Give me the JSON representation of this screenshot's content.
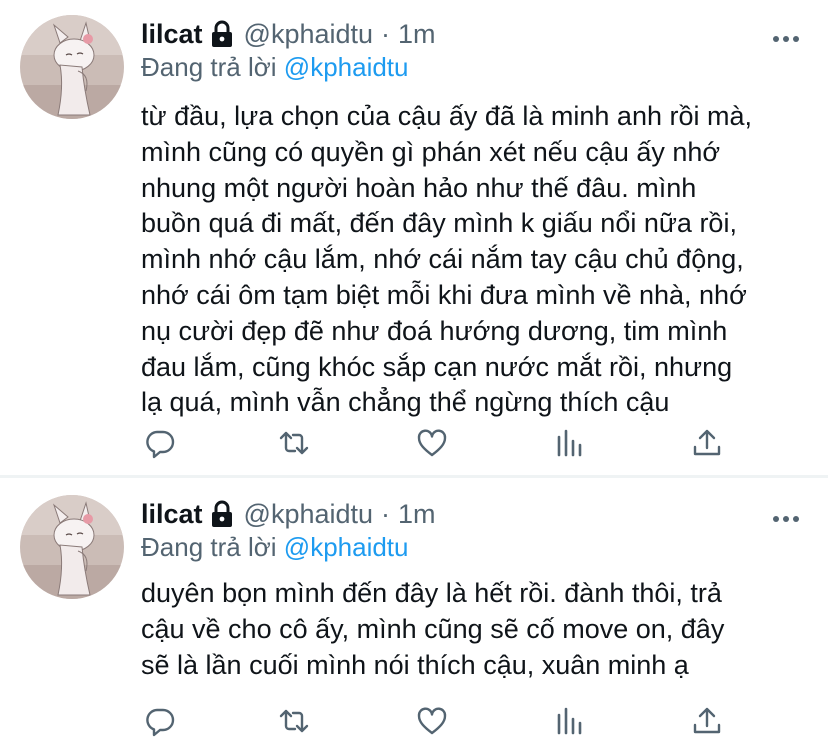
{
  "colors": {
    "text": "#0f1419",
    "secondary": "#536471",
    "link": "#1d9bf0",
    "divider": "#eff3f4"
  },
  "tweets": [
    {
      "display_name": "lilcat",
      "handle": "@kphaidtu",
      "separator": "·",
      "time": "1m",
      "reply_prefix": "Đang trả lời",
      "reply_to": "@kphaidtu",
      "lines": [
        "từ đầu, lựa chọn của cậu ấy đã là minh anh rồi mà,",
        "mình cũng có quyền gì phán xét nếu cậu ấy nhớ",
        "nhung một người hoàn hảo như thế đâu.  mình",
        "buồn quá đi mất, đến đây mình k giấu nổi nữa rồi,",
        "mình nhớ cậu lắm, nhớ cái nắm tay cậu chủ động,",
        "nhớ cái ôm tạm biệt mỗi khi đưa mình về nhà, nhớ",
        "nụ cười đẹp đẽ như đoá hướng dương, tim mình",
        "đau lắm, cũng khóc sắp cạn nước mắt rồi, nhưng",
        "lạ quá, mình vẫn chẳng thể ngừng thích cậu"
      ],
      "icons": [
        "reply-icon",
        "retweet-icon",
        "like-icon",
        "stats-icon",
        "share-icon"
      ]
    },
    {
      "display_name": "lilcat",
      "handle": "@kphaidtu",
      "separator": "·",
      "time": "1m",
      "reply_prefix": "Đang trả lời",
      "reply_to": "@kphaidtu",
      "lines": [
        "duyên bọn mình đến đây là hết rồi. đành thôi, trả",
        "cậu về cho cô ấy, mình cũng sẽ cố move on, đây",
        "sẽ là lần cuối mình nói thích cậu, xuân minh ạ"
      ],
      "icons": [
        "reply-icon",
        "retweet-icon",
        "like-icon",
        "stats-icon",
        "share-icon"
      ]
    }
  ]
}
